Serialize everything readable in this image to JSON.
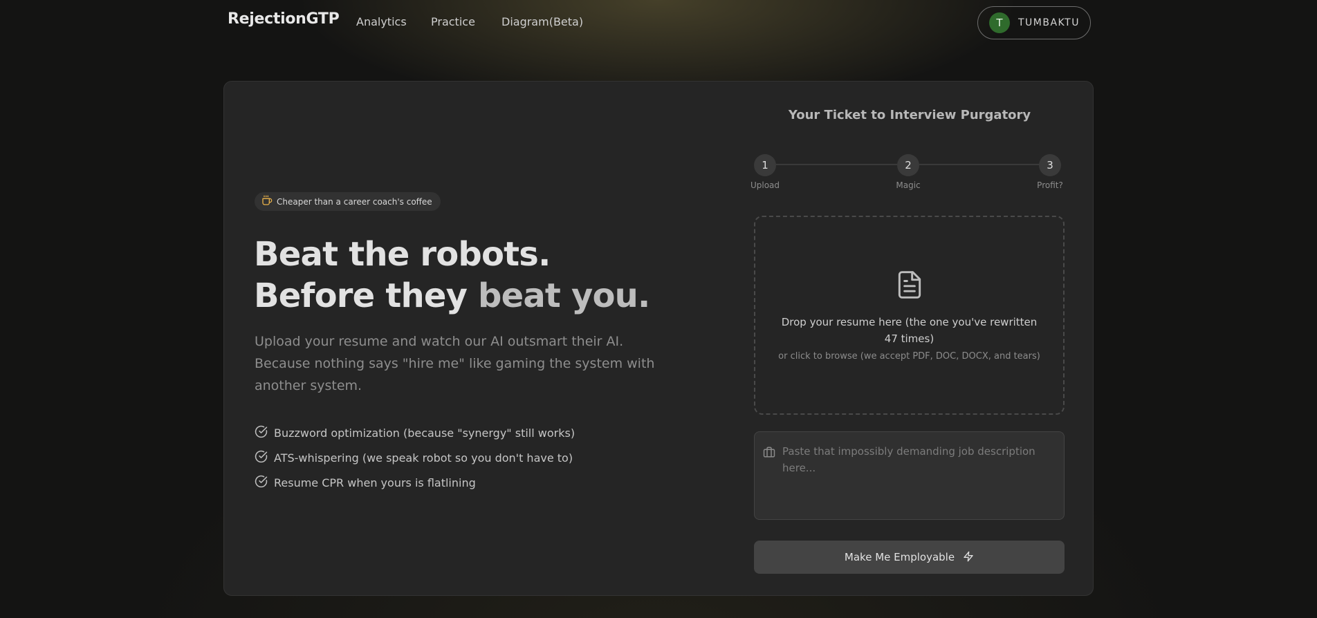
{
  "app": {
    "logo": "RejectionGTP"
  },
  "nav": {
    "links": [
      {
        "label": "Analytics"
      },
      {
        "label": "Practice"
      },
      {
        "label": "Diagram(Beta)"
      }
    ],
    "user": {
      "initial": "T",
      "name": "TUMBAKTU"
    }
  },
  "hero": {
    "badge": "Cheaper than a career coach's coffee",
    "headline_line1": "Beat the robots.",
    "headline_line2_a": "Before they ",
    "headline_line2_b": "beat you.",
    "subtext": "Upload your resume and watch our AI outsmart their AI. Because nothing says \"hire me\" like gaming the system with another system.",
    "features": [
      "Buzzword optimization (because \"synergy\" still works)",
      "ATS-whispering (we speak robot so you don't have to)",
      "Resume CPR when yours is flatlining"
    ]
  },
  "upload": {
    "title": "Your Ticket to Interview Purgatory",
    "steps": [
      {
        "number": "1",
        "label": "Upload"
      },
      {
        "number": "2",
        "label": "Magic"
      },
      {
        "number": "3",
        "label": "Profit?"
      }
    ],
    "dropzone_main": "Drop your resume here (the one you've rewritten 47 times)",
    "dropzone_sub": "or click to browse (we accept PDF, DOC, DOCX, and tears)",
    "job_placeholder": "Paste that impossibly demanding job description here...",
    "submit_label": "Make Me Employable"
  },
  "icons": {
    "badge": "coffee-cup-icon",
    "features": "check-circle-icon",
    "dropzone": "document-icon",
    "job": "briefcase-icon",
    "submit": "lightning-icon"
  },
  "colors": {
    "background": "#141413",
    "card": "#252525",
    "accent_badge": "#e8b14a",
    "avatar": "#2f6b2c",
    "button": "#444444"
  }
}
